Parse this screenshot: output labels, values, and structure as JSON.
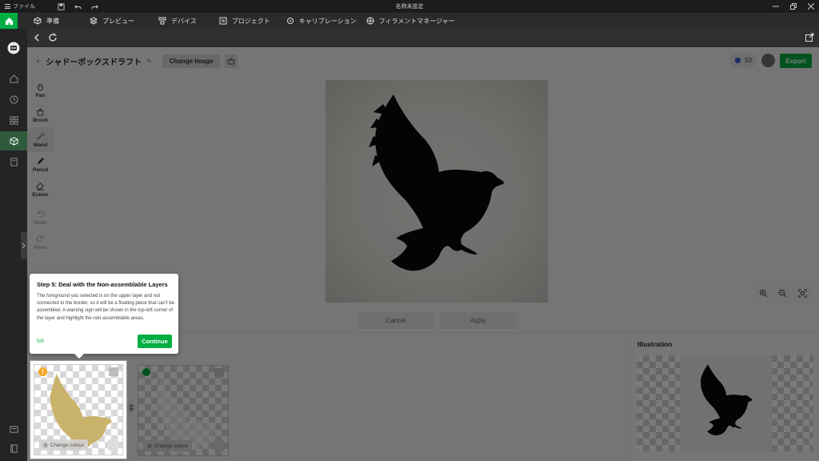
{
  "titlebar": {
    "menu_label": "ファイル",
    "window_title": "名称未設定"
  },
  "topnav": {
    "items": [
      {
        "label": "準備",
        "icon": "cube-icon"
      },
      {
        "label": "プレビュー",
        "icon": "layers-icon"
      },
      {
        "label": "デバイス",
        "icon": "device-icon"
      },
      {
        "label": "プロジェクト",
        "icon": "project-icon"
      },
      {
        "label": "キャリブレーション",
        "icon": "calibration-icon"
      },
      {
        "label": "フィラメントマネージャー",
        "icon": "filament-icon"
      }
    ]
  },
  "editor": {
    "project_name": "シャドーボックスドラフト",
    "change_image_label": "Change Image",
    "credits": "50",
    "export_label": "Export",
    "cancel_label": "Cancel",
    "apply_label": "Apply",
    "illustration_title": "Illustration",
    "layer_button_label": "Change colour",
    "layer_side_label": "GD"
  },
  "tools": [
    {
      "label": "Pan",
      "icon": "hand-icon"
    },
    {
      "label": "Brush",
      "icon": "brush-icon"
    },
    {
      "label": "Wand",
      "icon": "wand-icon"
    },
    {
      "label": "Pencil",
      "icon": "pencil-icon"
    },
    {
      "label": "Eraser",
      "icon": "eraser-icon"
    },
    {
      "label": "Undo",
      "icon": "undo-icon"
    },
    {
      "label": "Redo",
      "icon": "redo-icon"
    }
  ],
  "tooltip": {
    "title": "Step 5: Deal with the Non-assemblable Layers",
    "body": "The foreground you selected is on the upper layer and not connected to the border, so it will be a floating piece that can't be assembled. A warning sign will be shown in the top-left corner of the layer and highlight the non-assemblable areas.",
    "step": "5/5",
    "continue_label": "Continue"
  },
  "colors": {
    "accent": "#00ae42",
    "warning": "#f5a623",
    "silhouette": "#0a0a0a",
    "layer_fill": "#c9b36a"
  }
}
